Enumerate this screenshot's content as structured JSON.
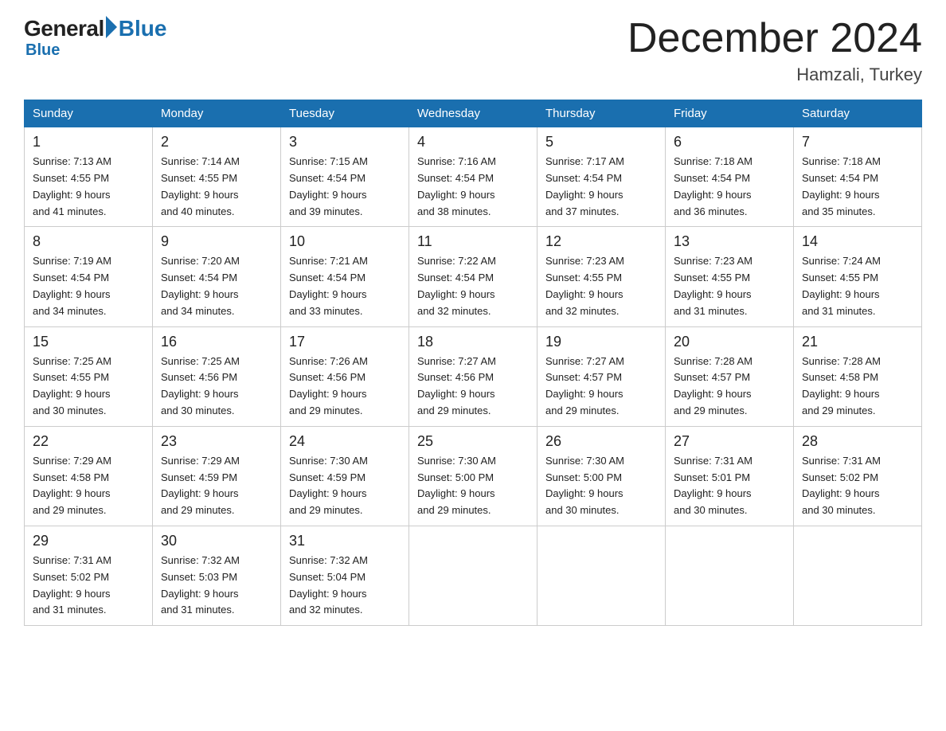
{
  "logo": {
    "general": "General",
    "blue": "Blue"
  },
  "title": "December 2024",
  "subtitle": "Hamzali, Turkey",
  "headers": [
    "Sunday",
    "Monday",
    "Tuesday",
    "Wednesday",
    "Thursday",
    "Friday",
    "Saturday"
  ],
  "weeks": [
    [
      {
        "day": "1",
        "sunrise": "7:13 AM",
        "sunset": "4:55 PM",
        "daylight": "9 hours and 41 minutes."
      },
      {
        "day": "2",
        "sunrise": "7:14 AM",
        "sunset": "4:55 PM",
        "daylight": "9 hours and 40 minutes."
      },
      {
        "day": "3",
        "sunrise": "7:15 AM",
        "sunset": "4:54 PM",
        "daylight": "9 hours and 39 minutes."
      },
      {
        "day": "4",
        "sunrise": "7:16 AM",
        "sunset": "4:54 PM",
        "daylight": "9 hours and 38 minutes."
      },
      {
        "day": "5",
        "sunrise": "7:17 AM",
        "sunset": "4:54 PM",
        "daylight": "9 hours and 37 minutes."
      },
      {
        "day": "6",
        "sunrise": "7:18 AM",
        "sunset": "4:54 PM",
        "daylight": "9 hours and 36 minutes."
      },
      {
        "day": "7",
        "sunrise": "7:18 AM",
        "sunset": "4:54 PM",
        "daylight": "9 hours and 35 minutes."
      }
    ],
    [
      {
        "day": "8",
        "sunrise": "7:19 AM",
        "sunset": "4:54 PM",
        "daylight": "9 hours and 34 minutes."
      },
      {
        "day": "9",
        "sunrise": "7:20 AM",
        "sunset": "4:54 PM",
        "daylight": "9 hours and 34 minutes."
      },
      {
        "day": "10",
        "sunrise": "7:21 AM",
        "sunset": "4:54 PM",
        "daylight": "9 hours and 33 minutes."
      },
      {
        "day": "11",
        "sunrise": "7:22 AM",
        "sunset": "4:54 PM",
        "daylight": "9 hours and 32 minutes."
      },
      {
        "day": "12",
        "sunrise": "7:23 AM",
        "sunset": "4:55 PM",
        "daylight": "9 hours and 32 minutes."
      },
      {
        "day": "13",
        "sunrise": "7:23 AM",
        "sunset": "4:55 PM",
        "daylight": "9 hours and 31 minutes."
      },
      {
        "day": "14",
        "sunrise": "7:24 AM",
        "sunset": "4:55 PM",
        "daylight": "9 hours and 31 minutes."
      }
    ],
    [
      {
        "day": "15",
        "sunrise": "7:25 AM",
        "sunset": "4:55 PM",
        "daylight": "9 hours and 30 minutes."
      },
      {
        "day": "16",
        "sunrise": "7:25 AM",
        "sunset": "4:56 PM",
        "daylight": "9 hours and 30 minutes."
      },
      {
        "day": "17",
        "sunrise": "7:26 AM",
        "sunset": "4:56 PM",
        "daylight": "9 hours and 29 minutes."
      },
      {
        "day": "18",
        "sunrise": "7:27 AM",
        "sunset": "4:56 PM",
        "daylight": "9 hours and 29 minutes."
      },
      {
        "day": "19",
        "sunrise": "7:27 AM",
        "sunset": "4:57 PM",
        "daylight": "9 hours and 29 minutes."
      },
      {
        "day": "20",
        "sunrise": "7:28 AM",
        "sunset": "4:57 PM",
        "daylight": "9 hours and 29 minutes."
      },
      {
        "day": "21",
        "sunrise": "7:28 AM",
        "sunset": "4:58 PM",
        "daylight": "9 hours and 29 minutes."
      }
    ],
    [
      {
        "day": "22",
        "sunrise": "7:29 AM",
        "sunset": "4:58 PM",
        "daylight": "9 hours and 29 minutes."
      },
      {
        "day": "23",
        "sunrise": "7:29 AM",
        "sunset": "4:59 PM",
        "daylight": "9 hours and 29 minutes."
      },
      {
        "day": "24",
        "sunrise": "7:30 AM",
        "sunset": "4:59 PM",
        "daylight": "9 hours and 29 minutes."
      },
      {
        "day": "25",
        "sunrise": "7:30 AM",
        "sunset": "5:00 PM",
        "daylight": "9 hours and 29 minutes."
      },
      {
        "day": "26",
        "sunrise": "7:30 AM",
        "sunset": "5:00 PM",
        "daylight": "9 hours and 30 minutes."
      },
      {
        "day": "27",
        "sunrise": "7:31 AM",
        "sunset": "5:01 PM",
        "daylight": "9 hours and 30 minutes."
      },
      {
        "day": "28",
        "sunrise": "7:31 AM",
        "sunset": "5:02 PM",
        "daylight": "9 hours and 30 minutes."
      }
    ],
    [
      {
        "day": "29",
        "sunrise": "7:31 AM",
        "sunset": "5:02 PM",
        "daylight": "9 hours and 31 minutes."
      },
      {
        "day": "30",
        "sunrise": "7:32 AM",
        "sunset": "5:03 PM",
        "daylight": "9 hours and 31 minutes."
      },
      {
        "day": "31",
        "sunrise": "7:32 AM",
        "sunset": "5:04 PM",
        "daylight": "9 hours and 32 minutes."
      },
      null,
      null,
      null,
      null
    ]
  ],
  "labels": {
    "sunrise": "Sunrise:",
    "sunset": "Sunset:",
    "daylight": "Daylight:"
  }
}
